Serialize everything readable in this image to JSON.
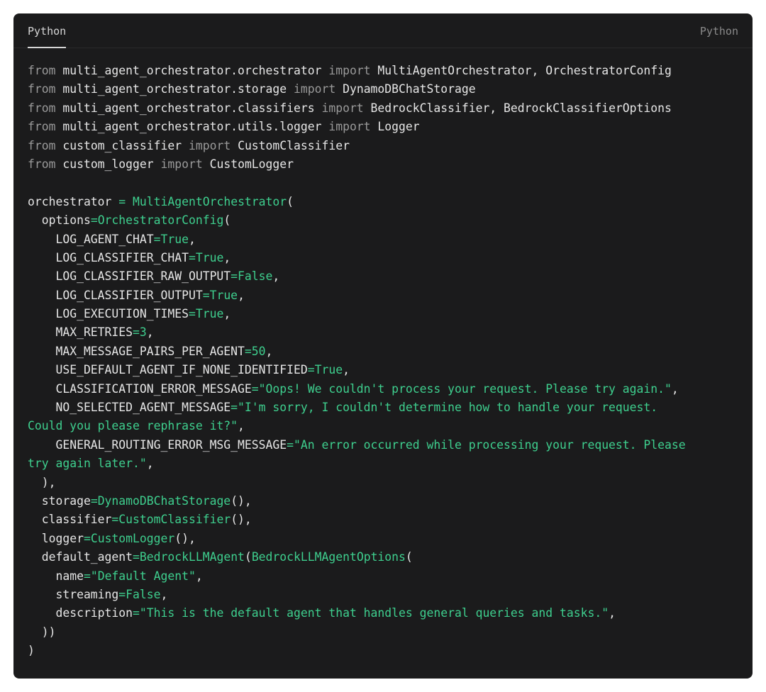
{
  "header": {
    "tab_label": "Python",
    "language_label": "Python"
  },
  "colors": {
    "background": "#1b1b1c",
    "default_text": "#e6e6e6",
    "keyword": "#9a9a9a",
    "accent_green": "#3ecf8e"
  },
  "code_lines": [
    [
      [
        "kw",
        "from"
      ],
      [
        "id",
        " multi_agent_orchestrator.orchestrator "
      ],
      [
        "kw",
        "import"
      ],
      [
        "id",
        " MultiAgentOrchestrator, OrchestratorConfig"
      ]
    ],
    [
      [
        "kw",
        "from"
      ],
      [
        "id",
        " multi_agent_orchestrator.storage "
      ],
      [
        "kw",
        "import"
      ],
      [
        "id",
        " DynamoDBChatStorage"
      ]
    ],
    [
      [
        "kw",
        "from"
      ],
      [
        "id",
        " multi_agent_orchestrator.classifiers "
      ],
      [
        "kw",
        "import"
      ],
      [
        "id",
        " BedrockClassifier, BedrockClassifierOptions"
      ]
    ],
    [
      [
        "kw",
        "from"
      ],
      [
        "id",
        " multi_agent_orchestrator.utils.logger "
      ],
      [
        "kw",
        "import"
      ],
      [
        "id",
        " Logger"
      ]
    ],
    [
      [
        "kw",
        "from"
      ],
      [
        "id",
        " custom_classifier "
      ],
      [
        "kw",
        "import"
      ],
      [
        "id",
        " CustomClassifier"
      ]
    ],
    [
      [
        "kw",
        "from"
      ],
      [
        "id",
        " custom_logger "
      ],
      [
        "kw",
        "import"
      ],
      [
        "id",
        " CustomLogger"
      ]
    ],
    [],
    [
      [
        "id",
        "orchestrator "
      ],
      [
        "op",
        "="
      ],
      [
        "id",
        " "
      ],
      [
        "fn",
        "MultiAgentOrchestrator"
      ],
      [
        "id",
        "("
      ]
    ],
    [
      [
        "id",
        "  options"
      ],
      [
        "op",
        "="
      ],
      [
        "fn",
        "OrchestratorConfig"
      ],
      [
        "id",
        "("
      ]
    ],
    [
      [
        "id",
        "    LOG_AGENT_CHAT"
      ],
      [
        "op",
        "="
      ],
      [
        "lit",
        "True"
      ],
      [
        "id",
        ","
      ]
    ],
    [
      [
        "id",
        "    LOG_CLASSIFIER_CHAT"
      ],
      [
        "op",
        "="
      ],
      [
        "lit",
        "True"
      ],
      [
        "id",
        ","
      ]
    ],
    [
      [
        "id",
        "    LOG_CLASSIFIER_RAW_OUTPUT"
      ],
      [
        "op",
        "="
      ],
      [
        "lit",
        "False"
      ],
      [
        "id",
        ","
      ]
    ],
    [
      [
        "id",
        "    LOG_CLASSIFIER_OUTPUT"
      ],
      [
        "op",
        "="
      ],
      [
        "lit",
        "True"
      ],
      [
        "id",
        ","
      ]
    ],
    [
      [
        "id",
        "    LOG_EXECUTION_TIMES"
      ],
      [
        "op",
        "="
      ],
      [
        "lit",
        "True"
      ],
      [
        "id",
        ","
      ]
    ],
    [
      [
        "id",
        "    MAX_RETRIES"
      ],
      [
        "op",
        "="
      ],
      [
        "num",
        "3"
      ],
      [
        "id",
        ","
      ]
    ],
    [
      [
        "id",
        "    MAX_MESSAGE_PAIRS_PER_AGENT"
      ],
      [
        "op",
        "="
      ],
      [
        "num",
        "50"
      ],
      [
        "id",
        ","
      ]
    ],
    [
      [
        "id",
        "    USE_DEFAULT_AGENT_IF_NONE_IDENTIFIED"
      ],
      [
        "op",
        "="
      ],
      [
        "lit",
        "True"
      ],
      [
        "id",
        ","
      ]
    ],
    [
      [
        "id",
        "    CLASSIFICATION_ERROR_MESSAGE"
      ],
      [
        "op",
        "="
      ],
      [
        "str",
        "\"Oops! We couldn't process your request. Please try again.\""
      ],
      [
        "id",
        ","
      ]
    ],
    [
      [
        "id",
        "    NO_SELECTED_AGENT_MESSAGE"
      ],
      [
        "op",
        "="
      ],
      [
        "str",
        "\"I'm sorry, I couldn't determine how to handle your request."
      ]
    ],
    [
      [
        "str",
        "Could you please rephrase it?\""
      ],
      [
        "id",
        ","
      ]
    ],
    [
      [
        "id",
        "    GENERAL_ROUTING_ERROR_MSG_MESSAGE"
      ],
      [
        "op",
        "="
      ],
      [
        "str",
        "\"An error occurred while processing your request. Please"
      ]
    ],
    [
      [
        "str",
        "try again later.\""
      ],
      [
        "id",
        ","
      ]
    ],
    [
      [
        "id",
        "  ),"
      ]
    ],
    [
      [
        "id",
        "  storage"
      ],
      [
        "op",
        "="
      ],
      [
        "fn",
        "DynamoDBChatStorage"
      ],
      [
        "id",
        "(),"
      ]
    ],
    [
      [
        "id",
        "  classifier"
      ],
      [
        "op",
        "="
      ],
      [
        "fn",
        "CustomClassifier"
      ],
      [
        "id",
        "(),"
      ]
    ],
    [
      [
        "id",
        "  logger"
      ],
      [
        "op",
        "="
      ],
      [
        "fn",
        "CustomLogger"
      ],
      [
        "id",
        "(),"
      ]
    ],
    [
      [
        "id",
        "  default_agent"
      ],
      [
        "op",
        "="
      ],
      [
        "fn",
        "BedrockLLMAgent"
      ],
      [
        "id",
        "("
      ],
      [
        "fn",
        "BedrockLLMAgentOptions"
      ],
      [
        "id",
        "("
      ]
    ],
    [
      [
        "id",
        "    name"
      ],
      [
        "op",
        "="
      ],
      [
        "str",
        "\"Default Agent\""
      ],
      [
        "id",
        ","
      ]
    ],
    [
      [
        "id",
        "    streaming"
      ],
      [
        "op",
        "="
      ],
      [
        "lit",
        "False"
      ],
      [
        "id",
        ","
      ]
    ],
    [
      [
        "id",
        "    description"
      ],
      [
        "op",
        "="
      ],
      [
        "str",
        "\"This is the default agent that handles general queries and tasks.\""
      ],
      [
        "id",
        ","
      ]
    ],
    [
      [
        "id",
        "  ))"
      ]
    ],
    [
      [
        "id",
        ")"
      ]
    ]
  ]
}
